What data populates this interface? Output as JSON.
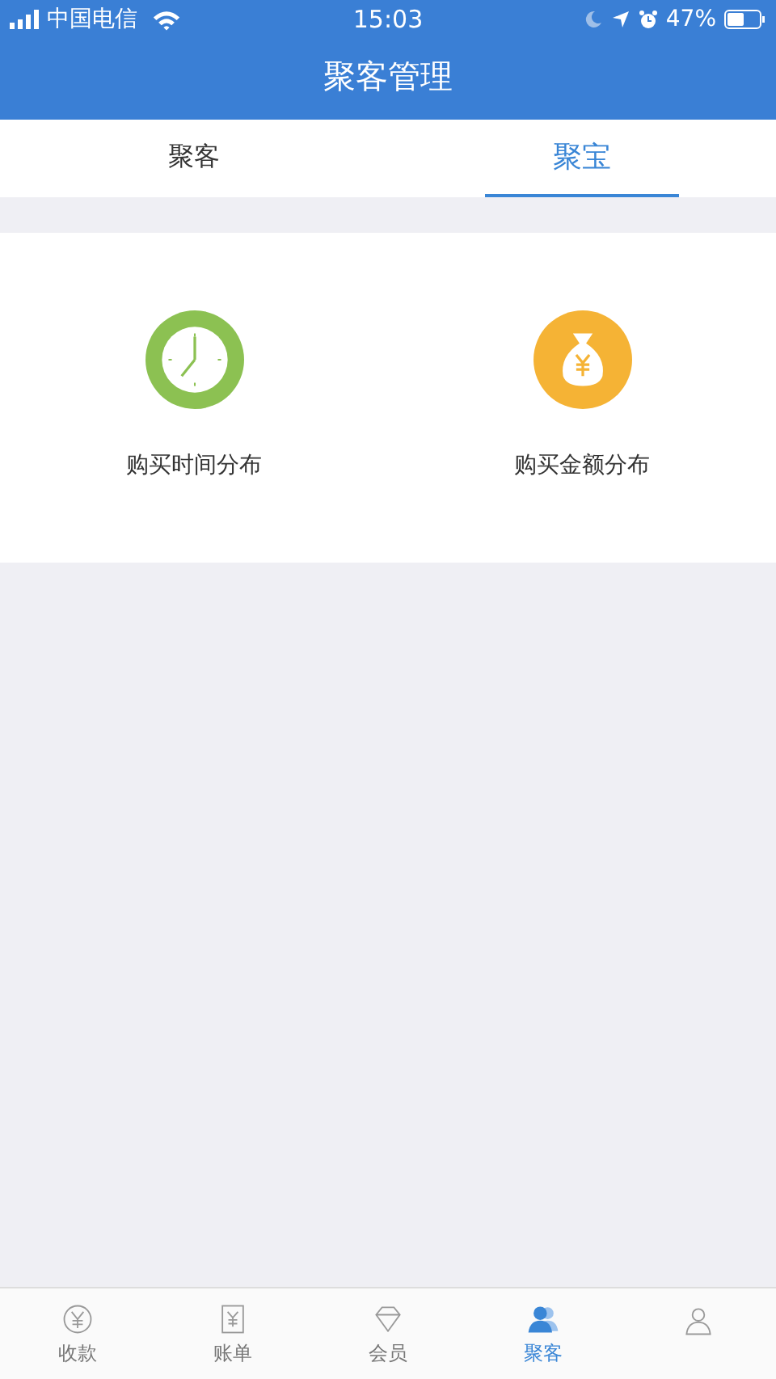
{
  "status_bar": {
    "carrier": "中国电信",
    "time": "15:03",
    "battery": "47%"
  },
  "header": {
    "title": "聚客管理"
  },
  "tabs": [
    {
      "label": "聚客",
      "selected": false
    },
    {
      "label": "聚宝",
      "selected": true
    }
  ],
  "features": [
    {
      "kind": "clock",
      "label": "购买时间分布"
    },
    {
      "kind": "moneybag",
      "label": "购买金额分布"
    }
  ],
  "bottom_nav": [
    {
      "kind": "coin",
      "label": "收款",
      "selected": false
    },
    {
      "kind": "bill",
      "label": "账单",
      "selected": false
    },
    {
      "kind": "diamond",
      "label": "会员",
      "selected": false
    },
    {
      "kind": "people",
      "label": "聚客",
      "selected": true
    },
    {
      "kind": "person",
      "selected": false
    }
  ]
}
